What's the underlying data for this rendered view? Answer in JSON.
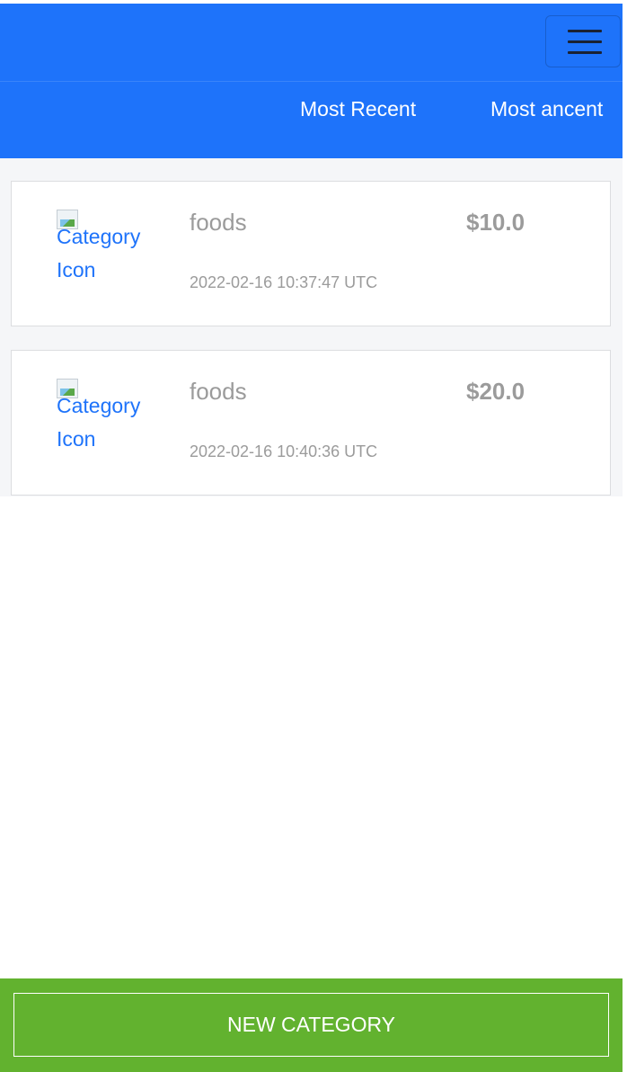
{
  "header": {
    "menu_icon": "hamburger-menu-icon",
    "accent_color": "#1e73fa"
  },
  "sort": {
    "most_recent_label": "Most Recent",
    "most_ancent_label": "Most ancent"
  },
  "categories": [
    {
      "icon_alt": "Category Icon",
      "name": "foods",
      "amount": "$10.0",
      "date": "2022-02-16 10:37:47 UTC"
    },
    {
      "icon_alt": "Category Icon",
      "name": "foods",
      "amount": "$20.0",
      "date": "2022-02-16 10:40:36 UTC"
    }
  ],
  "footer": {
    "new_category_label": "NEW CATEGORY",
    "accent_color": "#62b22f"
  }
}
